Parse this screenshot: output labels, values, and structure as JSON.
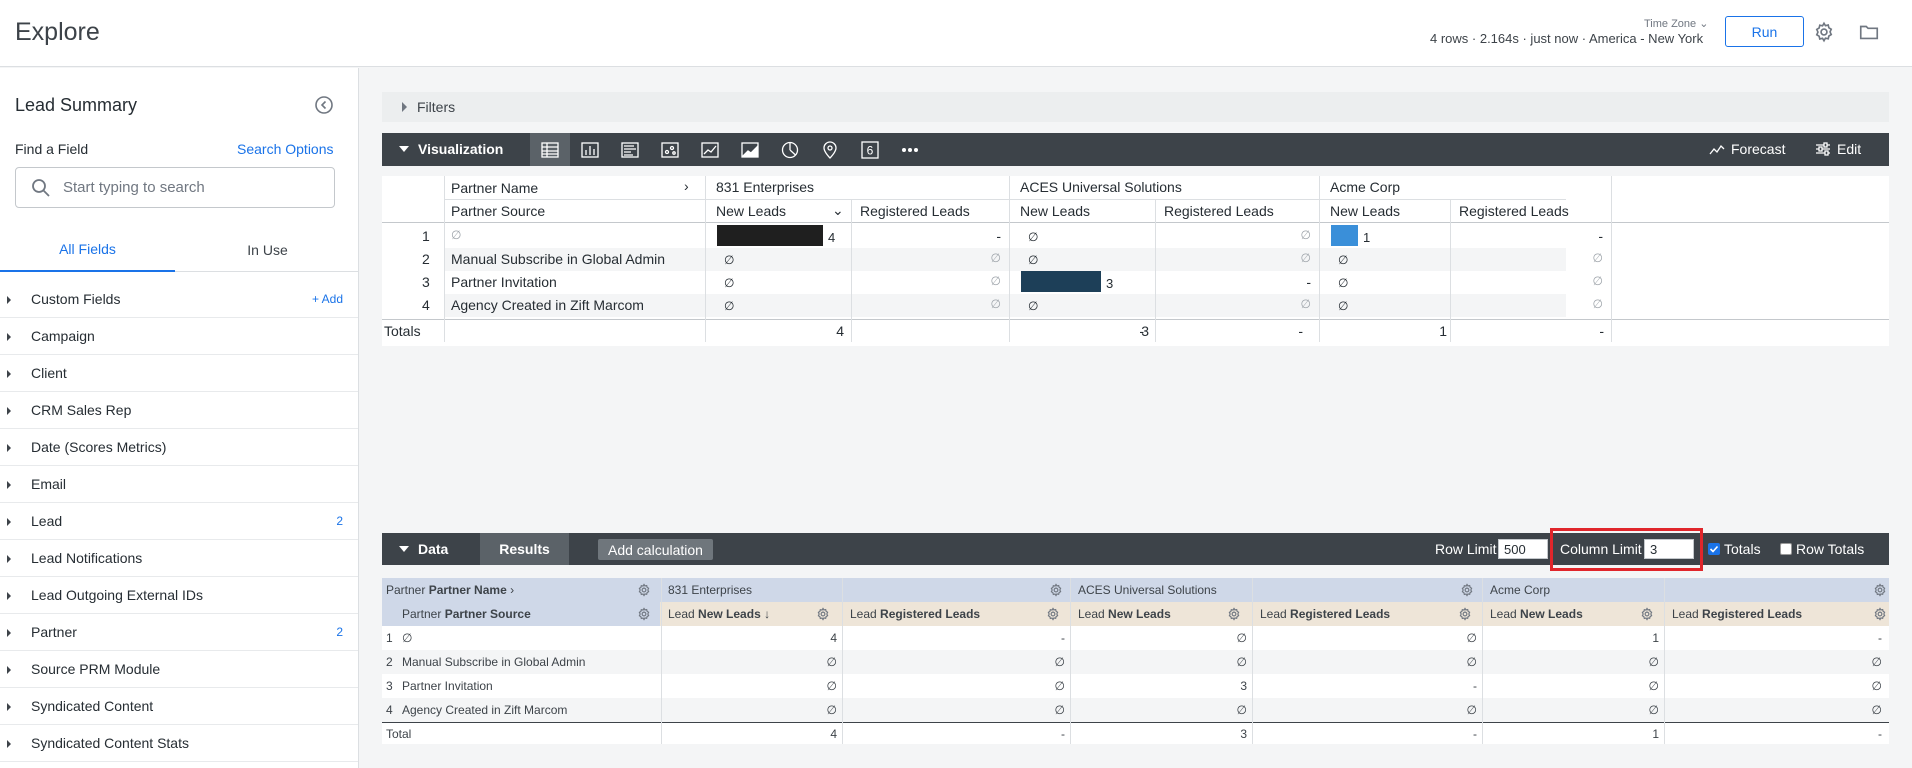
{
  "header": {
    "title": "Explore",
    "timezone_label": "Time Zone",
    "meta": "4 rows · 2.164s · just now · America - New York",
    "run_label": "Run"
  },
  "sidebar": {
    "title": "Lead Summary",
    "find_label": "Find a Field",
    "search_options": "Search Options",
    "search_placeholder": "Start typing to search",
    "tabs": [
      "All Fields",
      "In Use"
    ],
    "add_label": "Add",
    "fields": [
      {
        "label": "Custom Fields",
        "count": ""
      },
      {
        "label": "Campaign",
        "count": ""
      },
      {
        "label": "Client",
        "count": ""
      },
      {
        "label": "CRM Sales Rep",
        "count": ""
      },
      {
        "label": "Date (Scores Metrics)",
        "count": ""
      },
      {
        "label": "Email",
        "count": ""
      },
      {
        "label": "Lead",
        "count": "2"
      },
      {
        "label": "Lead Notifications",
        "count": ""
      },
      {
        "label": "Lead Outgoing External IDs",
        "count": ""
      },
      {
        "label": "Partner",
        "count": "2"
      },
      {
        "label": "Source PRM Module",
        "count": ""
      },
      {
        "label": "Syndicated Content",
        "count": ""
      },
      {
        "label": "Syndicated Content Stats",
        "count": ""
      }
    ]
  },
  "filters": {
    "label": "Filters"
  },
  "visualization": {
    "label": "Visualization",
    "icons": [
      "table-icon",
      "bar-chart-icon",
      "column-chart-icon",
      "scatter-icon",
      "line-chart-icon",
      "area-chart-icon",
      "pie-chart-icon",
      "map-pin-icon",
      "single-value-icon",
      "more-icon"
    ],
    "forecast_label": "Forecast",
    "edit_label": "Edit",
    "pivot_header": "Partner Name",
    "row_header": "Partner Source",
    "pivots": [
      "831 Enterprises",
      "ACES Universal Solutions",
      "Acme Corp"
    ],
    "measure_new": "New Leads",
    "measure_reg": "Registered Leads",
    "rows": [
      {
        "n": "1",
        "source": "∅",
        "cells": [
          "4",
          "-",
          "∅",
          "∅",
          "1",
          "-"
        ]
      },
      {
        "n": "2",
        "source": "Manual Subscribe in Global Admin",
        "cells": [
          "∅",
          "∅",
          "∅",
          "∅",
          "∅",
          "∅"
        ]
      },
      {
        "n": "3",
        "source": "Partner Invitation",
        "cells": [
          "∅",
          "∅",
          "3",
          "-",
          "∅",
          "∅"
        ]
      },
      {
        "n": "4",
        "source": "Agency Created in Zift Marcom",
        "cells": [
          "∅",
          "∅",
          "∅",
          "∅",
          "∅",
          "∅"
        ]
      }
    ],
    "totals_label": "Totals",
    "totals": [
      "4",
      "-",
      "3",
      "-",
      "1",
      "-"
    ],
    "bar_colors": [
      "#1f1f1f",
      "#1d3f58",
      "#3a8fd9"
    ],
    "bar_values": [
      4,
      3,
      1
    ],
    "bar_max": 4
  },
  "data": {
    "label": "Data",
    "results_label": "Results",
    "add_calc": "Add calculation",
    "row_limit_label": "Row Limit",
    "row_limit": "500",
    "col_limit_label": "Column Limit",
    "col_limit": "3",
    "totals_label": "Totals",
    "row_totals_label": "Row Totals",
    "pivot_view": "Partner",
    "pivot_field": "Partner Name",
    "row_view": "Partner",
    "row_field": "Partner Source",
    "measure_view": "Lead",
    "measure_new": "New Leads",
    "measure_reg": "Registered Leads",
    "pivots": [
      "831 Enterprises",
      "ACES Universal Solutions",
      "Acme Corp"
    ],
    "rows": [
      {
        "n": "1",
        "source": "∅",
        "cells": [
          "4",
          "-",
          "∅",
          "∅",
          "1",
          "-"
        ]
      },
      {
        "n": "2",
        "source": "Manual Subscribe in Global Admin",
        "cells": [
          "∅",
          "∅",
          "∅",
          "∅",
          "∅",
          "∅"
        ]
      },
      {
        "n": "3",
        "source": "Partner Invitation",
        "cells": [
          "∅",
          "∅",
          "3",
          "-",
          "∅",
          "∅"
        ]
      },
      {
        "n": "4",
        "source": "Agency Created in Zift Marcom",
        "cells": [
          "∅",
          "∅",
          "∅",
          "∅",
          "∅",
          "∅"
        ]
      }
    ],
    "total_label": "Total",
    "totals": [
      "4",
      "-",
      "3",
      "-",
      "1",
      "-"
    ]
  }
}
